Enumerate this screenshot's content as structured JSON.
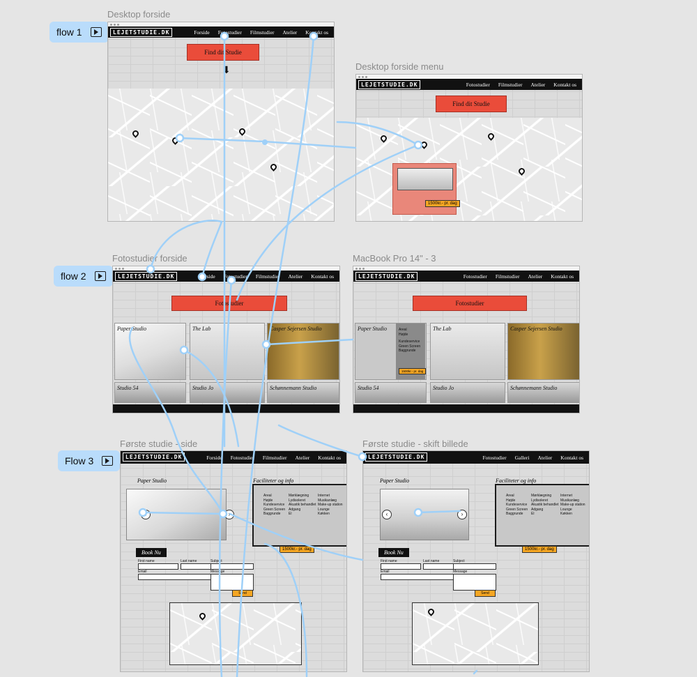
{
  "frames": {
    "desktop_forside": {
      "label": "Desktop forside",
      "logo": "LEJETSTUDIE.DK",
      "nav": [
        "Forside",
        "Fotostudier",
        "Filmstudier",
        "Atelier",
        "Kontakt os"
      ],
      "cta": "Find dit Studie"
    },
    "desktop_forside_menu": {
      "label": "Desktop forside menu",
      "logo": "LEJETSTUDIE.DK",
      "nav": [
        "Fotostudier",
        "Filmstudier",
        "Atelier",
        "Kontakt os"
      ],
      "cta": "Find dit Studie",
      "popup_price": "1500kr.- pr. dag"
    },
    "fotostudier_forside": {
      "label": "Fotostudier forside",
      "logo": "LEJETSTUDIE.DK",
      "nav": [
        "Forside",
        "Fotostudier",
        "Filmstudier",
        "Atelier",
        "Kontakt os"
      ],
      "cta": "Fotostudier",
      "tiles": [
        "Paper Studio",
        "The Lab",
        "Casper Sejersen Studio",
        "Studio 54",
        "Studio Jo",
        "Schønnemann Studio"
      ]
    },
    "macbook_pro_3": {
      "label": "MacBook Pro 14\" - 3",
      "logo": "LEJETSTUDIE.DK",
      "nav": [
        "Fotostudier",
        "Filmstudier",
        "Atelier",
        "Kontakt os"
      ],
      "cta": "Fotostudier",
      "tiles": [
        "Paper Studio",
        "The Lab",
        "Casper Sejersen Studio",
        "Studio 54",
        "Studio Jo",
        "Schønnemann Studio"
      ],
      "hover_items": [
        "Areal",
        "Højde",
        "Kundeservice",
        "Green Screen",
        "Baggrunde"
      ],
      "hover_price": "1500kr.- pr. dag"
    },
    "forste_studie_side": {
      "label": "Første studie - side",
      "logo": "LEJETSTUDIE.DK",
      "nav": [
        "Forside",
        "Fotostudier",
        "Filmstudier",
        "Atelier",
        "Kontakt os"
      ],
      "studio_title": "Paper Studio",
      "info_title": "Faciliteter og info",
      "info_col1": [
        "Areal",
        "Højde",
        "Kundeservice",
        "Green Screen",
        "Baggrunde"
      ],
      "info_col2": [
        "Mørklægning",
        "Lydisoleret",
        "Akustik behandlet",
        "Adgang",
        "El"
      ],
      "info_col3": [
        "Internet",
        "Musikanlæg",
        "Make-up station",
        "Lounge",
        "Køkken"
      ],
      "price": "1500kr.- pr. dag",
      "book": "Book Nu",
      "form_labels": [
        "First name",
        "Last name",
        "Email",
        "Subject",
        "Message"
      ],
      "send": "Send"
    },
    "forste_studie_skift": {
      "label": "Første studie - skift billede",
      "logo": "LEJETSTUDIE.DK",
      "nav": [
        "Fotostudier",
        "Galleri",
        "Atelier",
        "Kontakt os"
      ],
      "studio_title": "Paper Studio",
      "info_title": "Faciliteter og info",
      "info_col1": [
        "Areal",
        "Højde",
        "Kundeservice",
        "Green Screen",
        "Baggrunde"
      ],
      "info_col2": [
        "Mørklægning",
        "Lydisoleret",
        "Akustik behandlet",
        "Adgang",
        "El"
      ],
      "info_col3": [
        "Internet",
        "Musikanlæg",
        "Make-up station",
        "Lounge",
        "Køkken"
      ],
      "price": "1500kr.- pr. dag",
      "book": "Book Nu",
      "form_labels": [
        "First name",
        "Last name",
        "Email",
        "Subject",
        "Message"
      ],
      "send": "Send"
    }
  },
  "flows": [
    "flow 1",
    "flow 2",
    "Flow 3"
  ],
  "colors": {
    "accent": "#ea4c3a",
    "price": "#f5a623",
    "wire": "#9fd0f8",
    "flow_badge": "#b9dcfb"
  }
}
